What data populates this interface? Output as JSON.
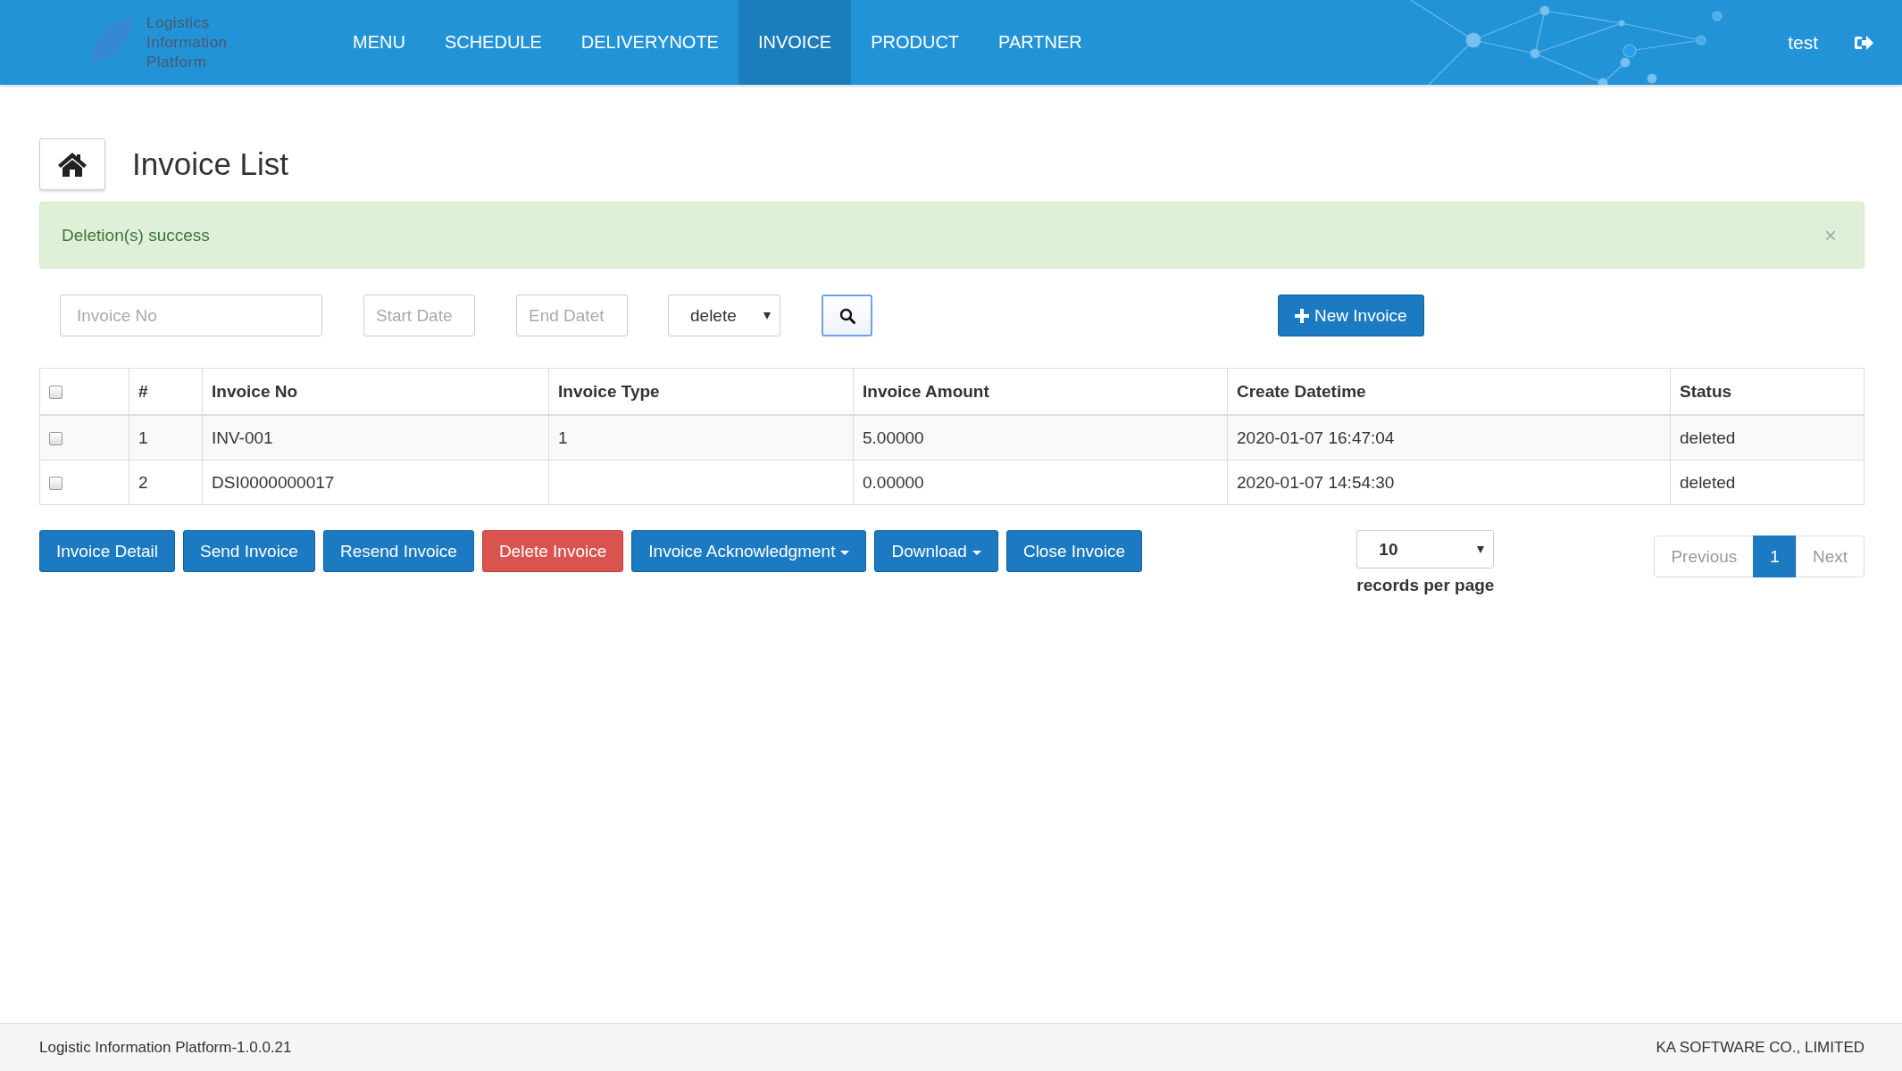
{
  "header": {
    "logo_text": "Logistics Information Platform",
    "nav": [
      {
        "label": "MENU",
        "selected": false
      },
      {
        "label": "SCHEDULE",
        "selected": false
      },
      {
        "label": "DELIVERYNOTE",
        "selected": false
      },
      {
        "label": "INVOICE",
        "selected": true
      },
      {
        "label": "PRODUCT",
        "selected": false
      },
      {
        "label": "PARTNER",
        "selected": false
      }
    ],
    "user": "test"
  },
  "page": {
    "title": "Invoice List"
  },
  "alert": {
    "message": "Deletion(s) success",
    "close": "×"
  },
  "filters": {
    "invoice_no": {
      "placeholder": "Invoice No"
    },
    "start_date": {
      "placeholder": "Start Date"
    },
    "end_date": {
      "placeholder": "End Datet"
    },
    "status": {
      "value": "delete"
    },
    "new_button": "New Invoice"
  },
  "table": {
    "select_all": {
      "checked": false
    },
    "columns": [
      "#",
      "Invoice No",
      "Invoice Type",
      "Invoice Amount",
      "Create Datetime",
      "Status"
    ],
    "rows": [
      {
        "checked": false,
        "cells": [
          "1",
          "INV-001",
          "1",
          "5.00000",
          "2020-01-07 16:47:04",
          "deleted"
        ]
      },
      {
        "checked": false,
        "cells": [
          "2",
          "DSI0000000017",
          "",
          "0.00000",
          "2020-01-07 14:54:30",
          "deleted"
        ]
      }
    ]
  },
  "actions": [
    {
      "label": "Invoice Detail",
      "kind": "primary",
      "dropdown": false
    },
    {
      "label": "Send Invoice",
      "kind": "primary",
      "dropdown": false
    },
    {
      "label": "Resend Invoice",
      "kind": "primary",
      "dropdown": false
    },
    {
      "label": "Delete Invoice",
      "kind": "danger",
      "dropdown": false
    },
    {
      "label": "Invoice Acknowledgment",
      "kind": "primary",
      "dropdown": true
    },
    {
      "label": "Download",
      "kind": "primary",
      "dropdown": true
    },
    {
      "label": "Close Invoice",
      "kind": "primary",
      "dropdown": false
    }
  ],
  "page_size": {
    "value": "10",
    "label": "records per page"
  },
  "pagination": {
    "previous": {
      "label": "Previous",
      "disabled": true
    },
    "pages": [
      {
        "label": "1",
        "selected": true
      }
    ],
    "next": {
      "label": "Next",
      "disabled": true
    }
  },
  "footer": {
    "left": "Logistic Information Platform-1.0.0.21",
    "right": "KA SOFTWARE CO., LIMITED"
  }
}
